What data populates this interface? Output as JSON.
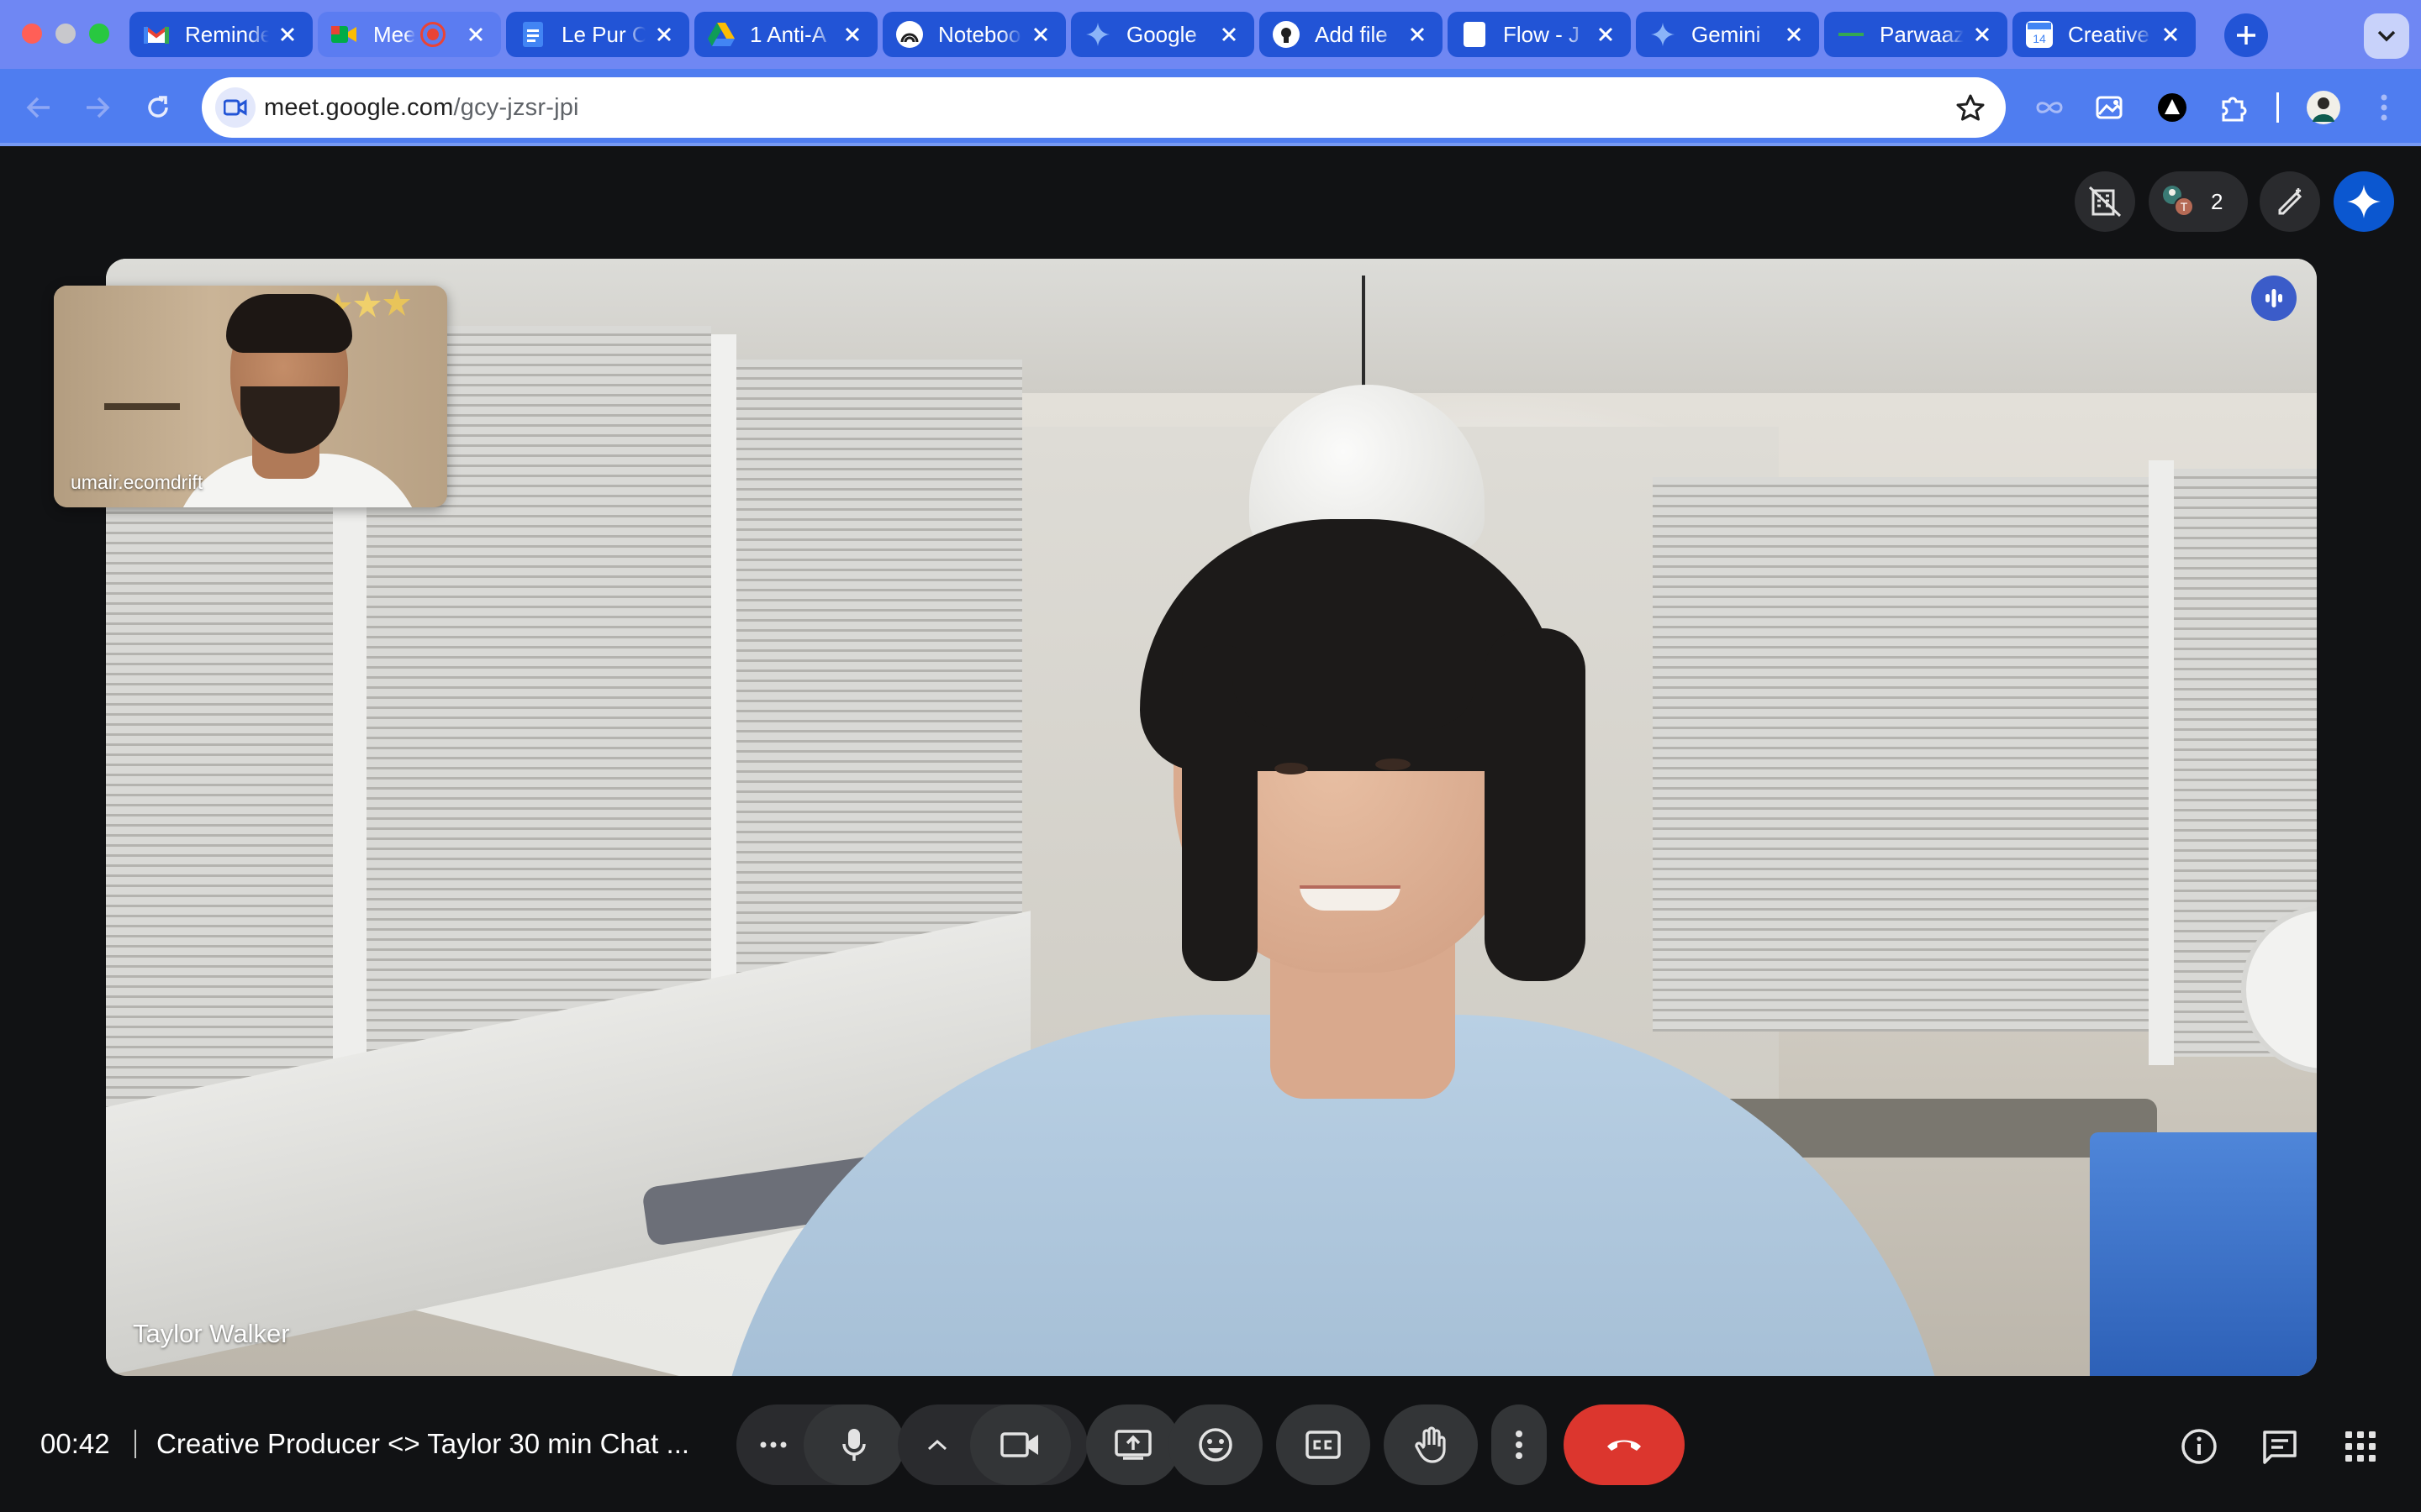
{
  "browser": {
    "tabs": [
      {
        "title": "Reminder",
        "favicon": "gmail-icon",
        "color": "#ea4335"
      },
      {
        "title": "Meet",
        "favicon": "meet-icon",
        "color": "#00897b",
        "recording": true
      },
      {
        "title": "Le Pur Co",
        "favicon": "docs-icon",
        "color": "#4285f4"
      },
      {
        "title": "1 Anti-A",
        "favicon": "drive-icon",
        "color": "#fbbc04"
      },
      {
        "title": "Notebook",
        "favicon": "notebooklm-icon",
        "color": "#ffffff"
      },
      {
        "title": "Google",
        "favicon": "gemini-icon",
        "color": "#7b8cff"
      },
      {
        "title": "Add file",
        "favicon": "github-icon",
        "color": "#ffffff"
      },
      {
        "title": "Flow - J",
        "favicon": "page-icon",
        "color": "#ffffff"
      },
      {
        "title": "Gemini",
        "favicon": "gemini-icon",
        "color": "#7b8cff"
      },
      {
        "title": "Parwaaz",
        "favicon": "flag-icon",
        "color": "#34a853"
      },
      {
        "title": "Creative",
        "favicon": "calendar-icon",
        "color": "#4285f4"
      }
    ],
    "url_host": "meet.google.com",
    "url_path": "/gcy-jzsr-jpi"
  },
  "meet": {
    "participant_count": "2",
    "main_speaker": "Taylor Walker",
    "self_name": "umair.ecomdrift",
    "time": "00:42",
    "meeting_title": "Creative Producer <> Taylor 30 min Chat ..."
  },
  "colors": {
    "tabbar": "#6f87f3",
    "tab": "#2254d6",
    "toolbar": "#4f7df0",
    "end_call": "#dc362e",
    "stage": "#111214"
  }
}
